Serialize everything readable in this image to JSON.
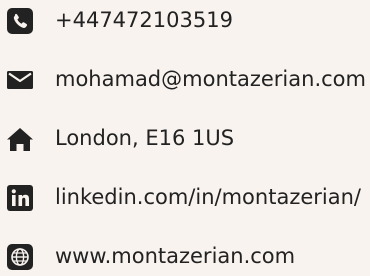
{
  "contact": {
    "phone": {
      "text": "+447472103519",
      "icon": "phone-icon"
    },
    "email": {
      "text": "mohamad@montazerian.com",
      "icon": "envelope-icon"
    },
    "address": {
      "text": "London, E16 1US",
      "icon": "home-icon"
    },
    "linkedin": {
      "text": "linkedin.com/in/montazerian/",
      "icon": "linkedin-icon"
    },
    "website": {
      "text": "www.montazerian.com",
      "icon": "globe-icon"
    }
  },
  "colors": {
    "background": "#f8f3ef",
    "icon": "#222222",
    "text": "#222222"
  }
}
